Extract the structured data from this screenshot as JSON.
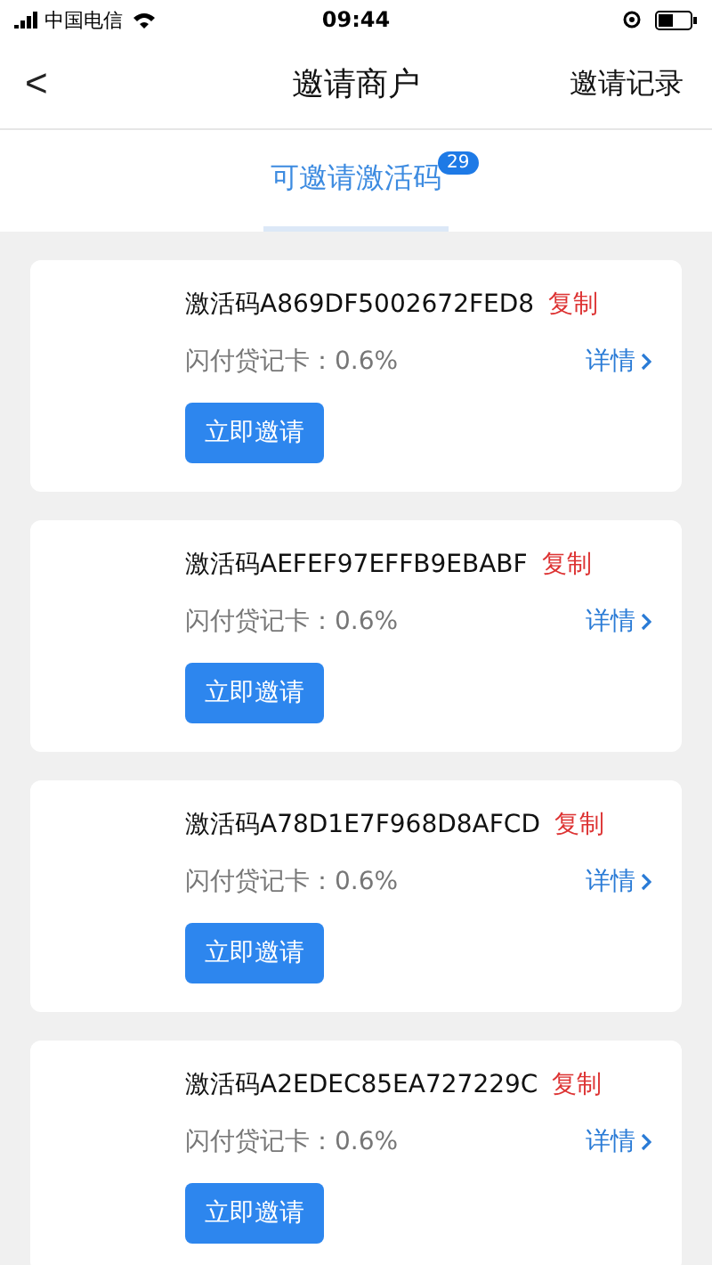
{
  "status_bar": {
    "carrier": "中国电信",
    "time": "09:44"
  },
  "nav": {
    "back": "<",
    "title": "邀请商户",
    "action": "邀请记录"
  },
  "tabs": [
    {
      "label": "可邀请激活码",
      "badge": "29",
      "selected": true
    }
  ],
  "cards": [
    {
      "code": "激活码A869DF5002672FED8",
      "copy": "复制",
      "rate": "闪付贷记卡：0.6%",
      "detail": "详情",
      "button": "立即邀请"
    },
    {
      "code": "激活码AEFEF97EFFB9EBABF",
      "copy": "复制",
      "rate": "闪付贷记卡：0.6%",
      "detail": "详情",
      "button": "立即邀请"
    },
    {
      "code": "激活码A78D1E7F968D8AFCD",
      "copy": "复制",
      "rate": "闪付贷记卡：0.6%",
      "detail": "详情",
      "button": "立即邀请"
    },
    {
      "code": "激活码A2EDEC85EA727229C",
      "copy": "复制",
      "rate": "闪付贷记卡：0.6%",
      "detail": "详情",
      "button": "立即邀请"
    }
  ]
}
